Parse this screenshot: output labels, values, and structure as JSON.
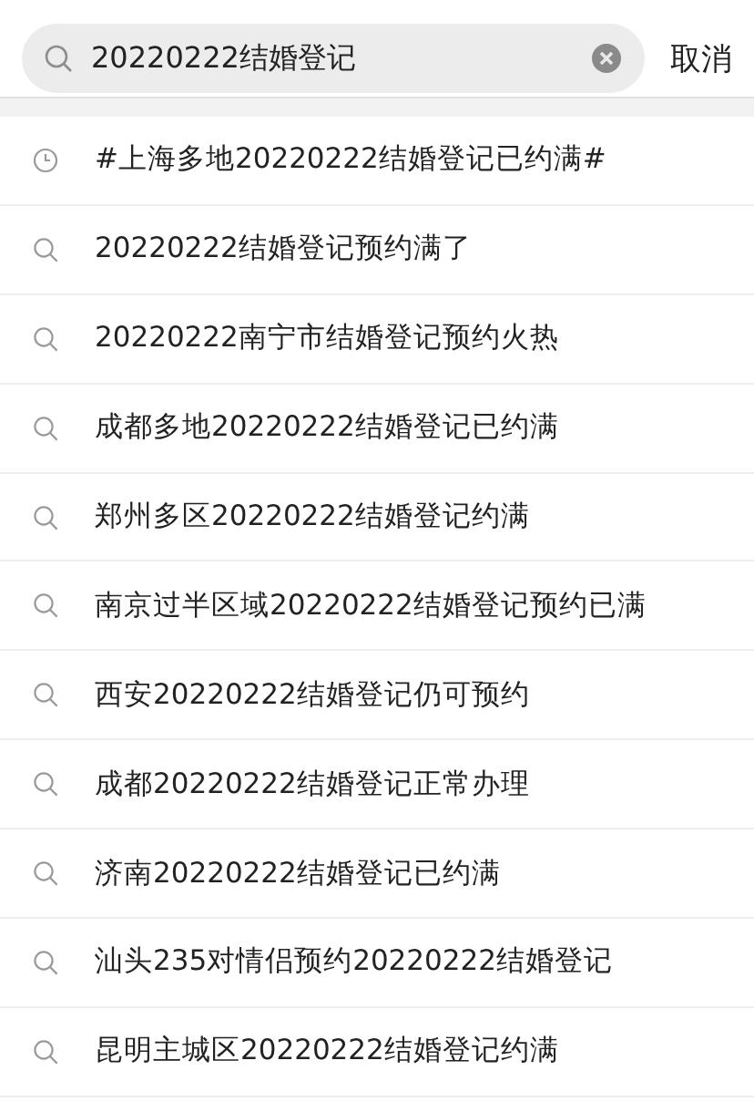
{
  "search": {
    "value": "20220222结婚登记",
    "cancel": "取消"
  },
  "suggestions": [
    {
      "kind": "history",
      "text": "#上海多地20220222结婚登记已约满#"
    },
    {
      "kind": "suggestion",
      "text": "20220222结婚登记预约满了"
    },
    {
      "kind": "suggestion",
      "text": "20220222南宁市结婚登记预约火热"
    },
    {
      "kind": "suggestion",
      "text": "成都多地20220222结婚登记已约满"
    },
    {
      "kind": "suggestion",
      "text": "郑州多区20220222结婚登记约满"
    },
    {
      "kind": "suggestion",
      "text": "南京过半区域20220222结婚登记预约已满"
    },
    {
      "kind": "suggestion",
      "text": "西安20220222结婚登记仍可预约"
    },
    {
      "kind": "suggestion",
      "text": "成都20220222结婚登记正常办理"
    },
    {
      "kind": "suggestion",
      "text": "济南20220222结婚登记已约满"
    },
    {
      "kind": "suggestion",
      "text": "汕头235对情侣预约20220222结婚登记"
    },
    {
      "kind": "suggestion",
      "text": "昆明主城区20220222结婚登记约满"
    }
  ]
}
